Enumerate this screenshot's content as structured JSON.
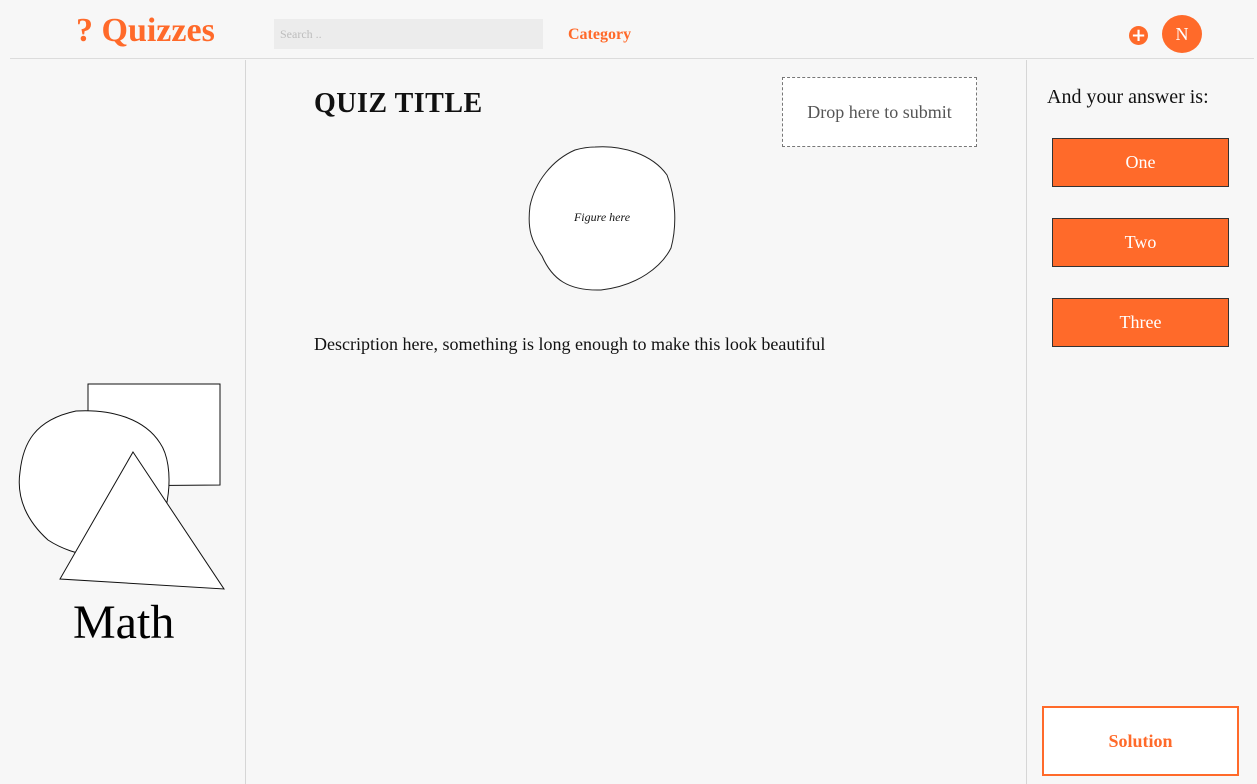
{
  "header": {
    "logo": "? Quizzes",
    "search_placeholder": "Search ..",
    "category_label": "Category",
    "add_icon": "plus-circle-icon",
    "avatar_initial": "N"
  },
  "left_panel": {
    "category_name": "Math",
    "illustration": "geometric-shapes-icon"
  },
  "main": {
    "quiz_title": "QUIZ TITLE",
    "drop_zone_label": "Drop here to submit",
    "figure_placeholder": "Figure here",
    "description": "Description here, something is long enough to make this look beautiful"
  },
  "answers": {
    "prompt": "And your answer is:",
    "options": [
      "One",
      "Two",
      "Three"
    ],
    "solution_label": "Solution"
  },
  "colors": {
    "accent": "#ff6a2a",
    "background": "#f7f7f7"
  }
}
